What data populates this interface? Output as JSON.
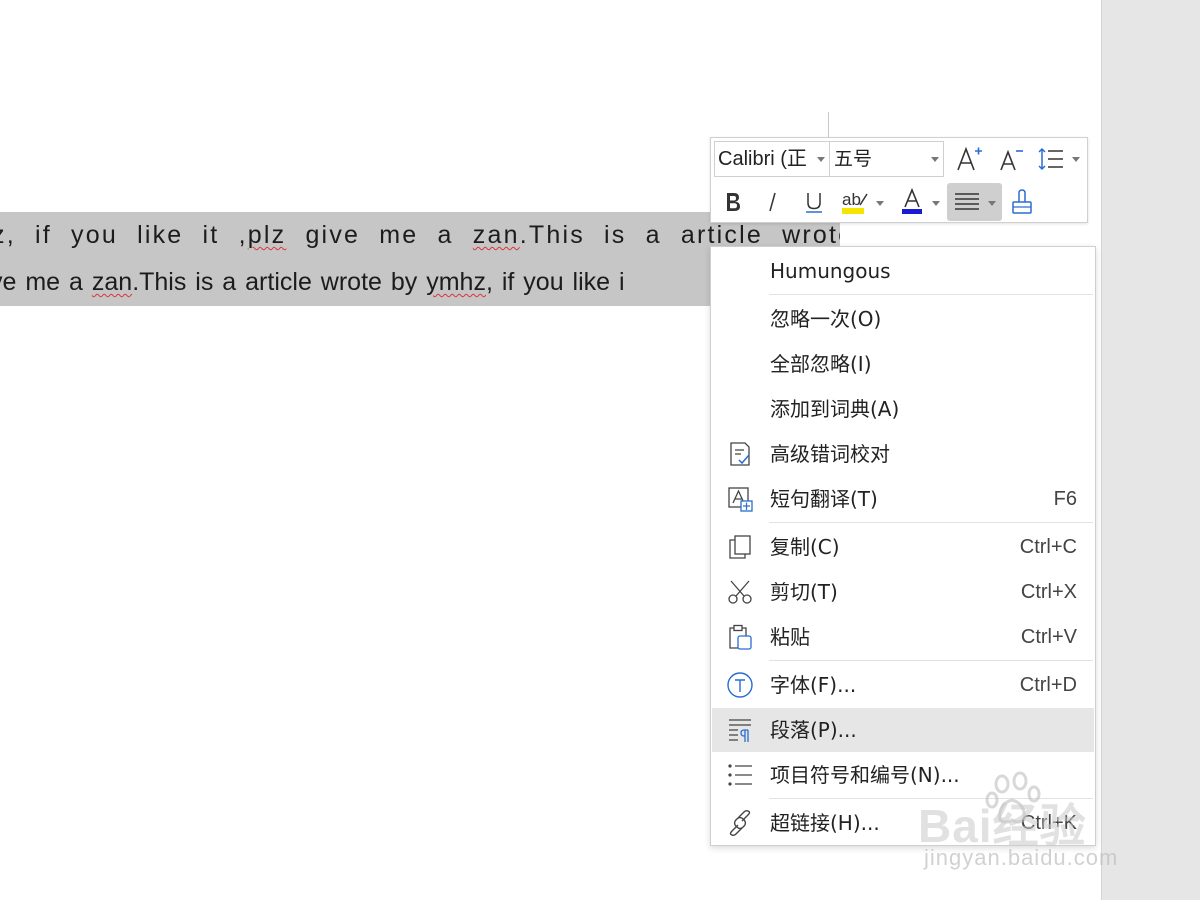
{
  "document": {
    "line1": {
      "pre": "z, if you like it ,",
      "sq1": "plz",
      "mid1": " give me a ",
      "sq2": "zan",
      "post": ".This is a article wrote by"
    },
    "line2": {
      "pre": "ve me a ",
      "sq1": "zan",
      "mid1": ".This is a article wrote by ",
      "sq2": "ymhz",
      "post": ", if you like i"
    }
  },
  "toolbar": {
    "font_name": "Calibri (正",
    "font_size": "五号",
    "buttons": [
      {
        "name": "grow-font-icon"
      },
      {
        "name": "shrink-font-icon"
      },
      {
        "name": "line-spacing-icon"
      },
      {
        "name": "bold-icon"
      },
      {
        "name": "italic-icon"
      },
      {
        "name": "underline-icon"
      },
      {
        "name": "highlight-icon"
      },
      {
        "name": "font-color-icon"
      },
      {
        "name": "align-icon"
      },
      {
        "name": "format-painter-icon"
      }
    ],
    "highlight_color": "#f5e600",
    "font_color": "#1b1bd1"
  },
  "menu": {
    "suggestion": "Humungous",
    "items": [
      {
        "label": "忽略一次(O)",
        "shortcut": "",
        "icon": ""
      },
      {
        "label": "全部忽略(I)",
        "shortcut": "",
        "icon": ""
      },
      {
        "label": "添加到词典(A)",
        "shortcut": "",
        "icon": ""
      },
      {
        "label": "高级错词校对",
        "shortcut": "",
        "icon": "proofread-icon"
      },
      {
        "label": "短句翻译(T)",
        "shortcut": "F6",
        "icon": "translate-icon"
      },
      {
        "label": "复制(C)",
        "shortcut": "Ctrl+C",
        "icon": "copy-icon"
      },
      {
        "label": "剪切(T)",
        "shortcut": "Ctrl+X",
        "icon": "scissors-icon"
      },
      {
        "label": "粘贴",
        "shortcut": "Ctrl+V",
        "icon": "paste-icon"
      },
      {
        "label": "字体(F)...",
        "shortcut": "Ctrl+D",
        "icon": "font-icon"
      },
      {
        "label": "段落(P)...",
        "shortcut": "",
        "icon": "paragraph-icon"
      },
      {
        "label": "项目符号和编号(N)...",
        "shortcut": "",
        "icon": "bullets-icon"
      },
      {
        "label": "超链接(H)...",
        "shortcut": "Ctrl+K",
        "icon": "link-icon"
      }
    ],
    "hover_item": "段落(P)..."
  },
  "watermark": {
    "main": "Bai经验",
    "sub": "jingyan.baidu.com"
  }
}
